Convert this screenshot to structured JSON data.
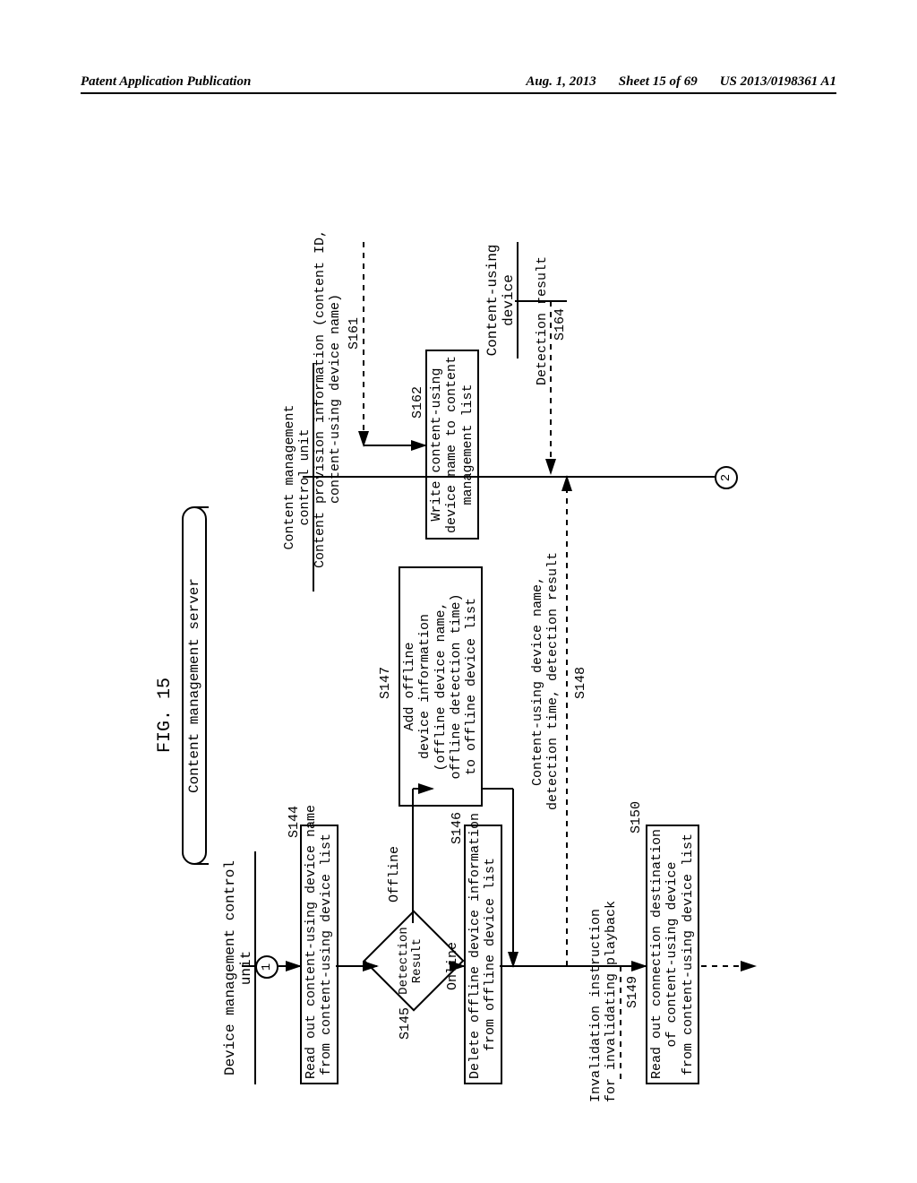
{
  "header": {
    "left": "Patent Application Publication",
    "date": "Aug. 1, 2013",
    "sheet": "Sheet 15 of 69",
    "pubno": "US 2013/0198361 A1"
  },
  "figure": {
    "label": "FIG. 15",
    "banner": "Content management server",
    "lanes": {
      "device_mgmt": "Device management control unit",
      "content_mgmt": "Content management\ncontrol unit",
      "content_using": "Content-using\ndevice"
    },
    "steps": {
      "s144_label": "S144",
      "s144_text": "Read out content-using device name\nfrom content-using device list",
      "s145_label": "S145",
      "s145_text": "Detection\nResult",
      "s145_online": "Online",
      "s145_offline": "Offline",
      "s146_label": "S146",
      "s146_text": "Delete offline device information\nfrom offline device list",
      "s147_label": "S147",
      "s147_text": "Add offline\ndevice information\n(offline device name,\noffline detection time)\nto offline device list",
      "s148_label": "S148",
      "s148_text": "Content-using device name,\ndetection time, detection result",
      "s149_label": "S149",
      "s149_text": "Invalidation instruction\nfor invalidating playback",
      "s150_label": "S150",
      "s150_text": "Read out connection destination\nof content-using device\nfrom content-using device list",
      "s161_label": "S161",
      "s161_text": "Content provision information\n(content ID, content-using device name)",
      "s162_label": "S162",
      "s162_text": "Write content-using\ndevice name to content\nmanagement list",
      "s164_label": "S164",
      "s164_text": "Detection result"
    },
    "connectors": {
      "c1": "1",
      "c2": "2"
    }
  }
}
